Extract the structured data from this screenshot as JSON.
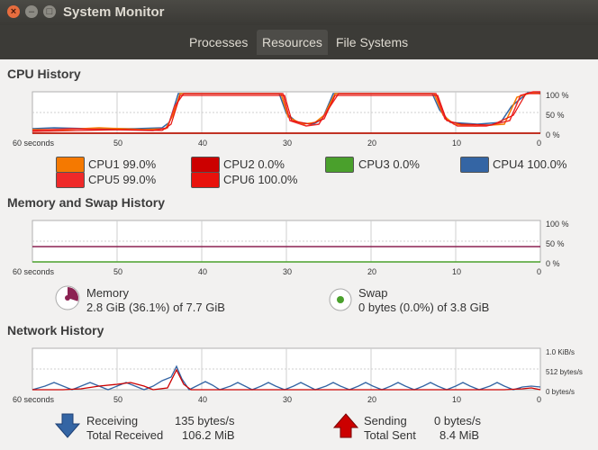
{
  "window": {
    "title": "System Monitor"
  },
  "tabs": [
    {
      "label": "Processes"
    },
    {
      "label": "Resources"
    },
    {
      "label": "File Systems"
    }
  ],
  "cpu": {
    "title": "CPU History",
    "y_ticks": [
      "100 %",
      "50 %",
      "0 %"
    ],
    "x_ticks": [
      "60 seconds",
      "50",
      "40",
      "30",
      "20",
      "10",
      "0"
    ],
    "legend": [
      {
        "label": "CPU1",
        "value": "99.0%",
        "color": "#f57900"
      },
      {
        "label": "CPU2",
        "value": "0.0%",
        "color": "#cc0000"
      },
      {
        "label": "CPU3",
        "value": "0.0%",
        "color": "#4aa02c"
      },
      {
        "label": "CPU4",
        "value": "100.0%",
        "color": "#3465a4"
      },
      {
        "label": "CPU5",
        "value": "99.0%",
        "color": "#ef2929"
      },
      {
        "label": "CPU6",
        "value": "100.0%",
        "color": "#e8120c"
      }
    ]
  },
  "memory": {
    "title": "Memory and Swap History",
    "y_ticks": [
      "100 %",
      "50 %",
      "0 %"
    ],
    "x_ticks": [
      "60 seconds",
      "50",
      "40",
      "30",
      "20",
      "10",
      "0"
    ],
    "memory_label": "Memory",
    "memory_value": "2.8 GiB (36.1%) of 7.7 GiB",
    "memory_color": "#8b2252",
    "swap_label": "Swap",
    "swap_value": "0 bytes (0.0%) of 3.8 GiB",
    "swap_color": "#4aa02c"
  },
  "network": {
    "title": "Network History",
    "y_ticks": [
      "1.0 KiB/s",
      "512 bytes/s",
      "0 bytes/s"
    ],
    "x_ticks": [
      "60 seconds",
      "50",
      "40",
      "30",
      "20",
      "10",
      "0"
    ],
    "receiving_label": "Receiving",
    "receiving_value": "135 bytes/s",
    "total_received_label": "Total Received",
    "total_received_value": "106.2 MiB",
    "sending_label": "Sending",
    "sending_value": "0 bytes/s",
    "total_sent_label": "Total Sent",
    "total_sent_value": "8.4 MiB",
    "receive_color": "#3465a4",
    "send_color": "#cc0000"
  }
}
